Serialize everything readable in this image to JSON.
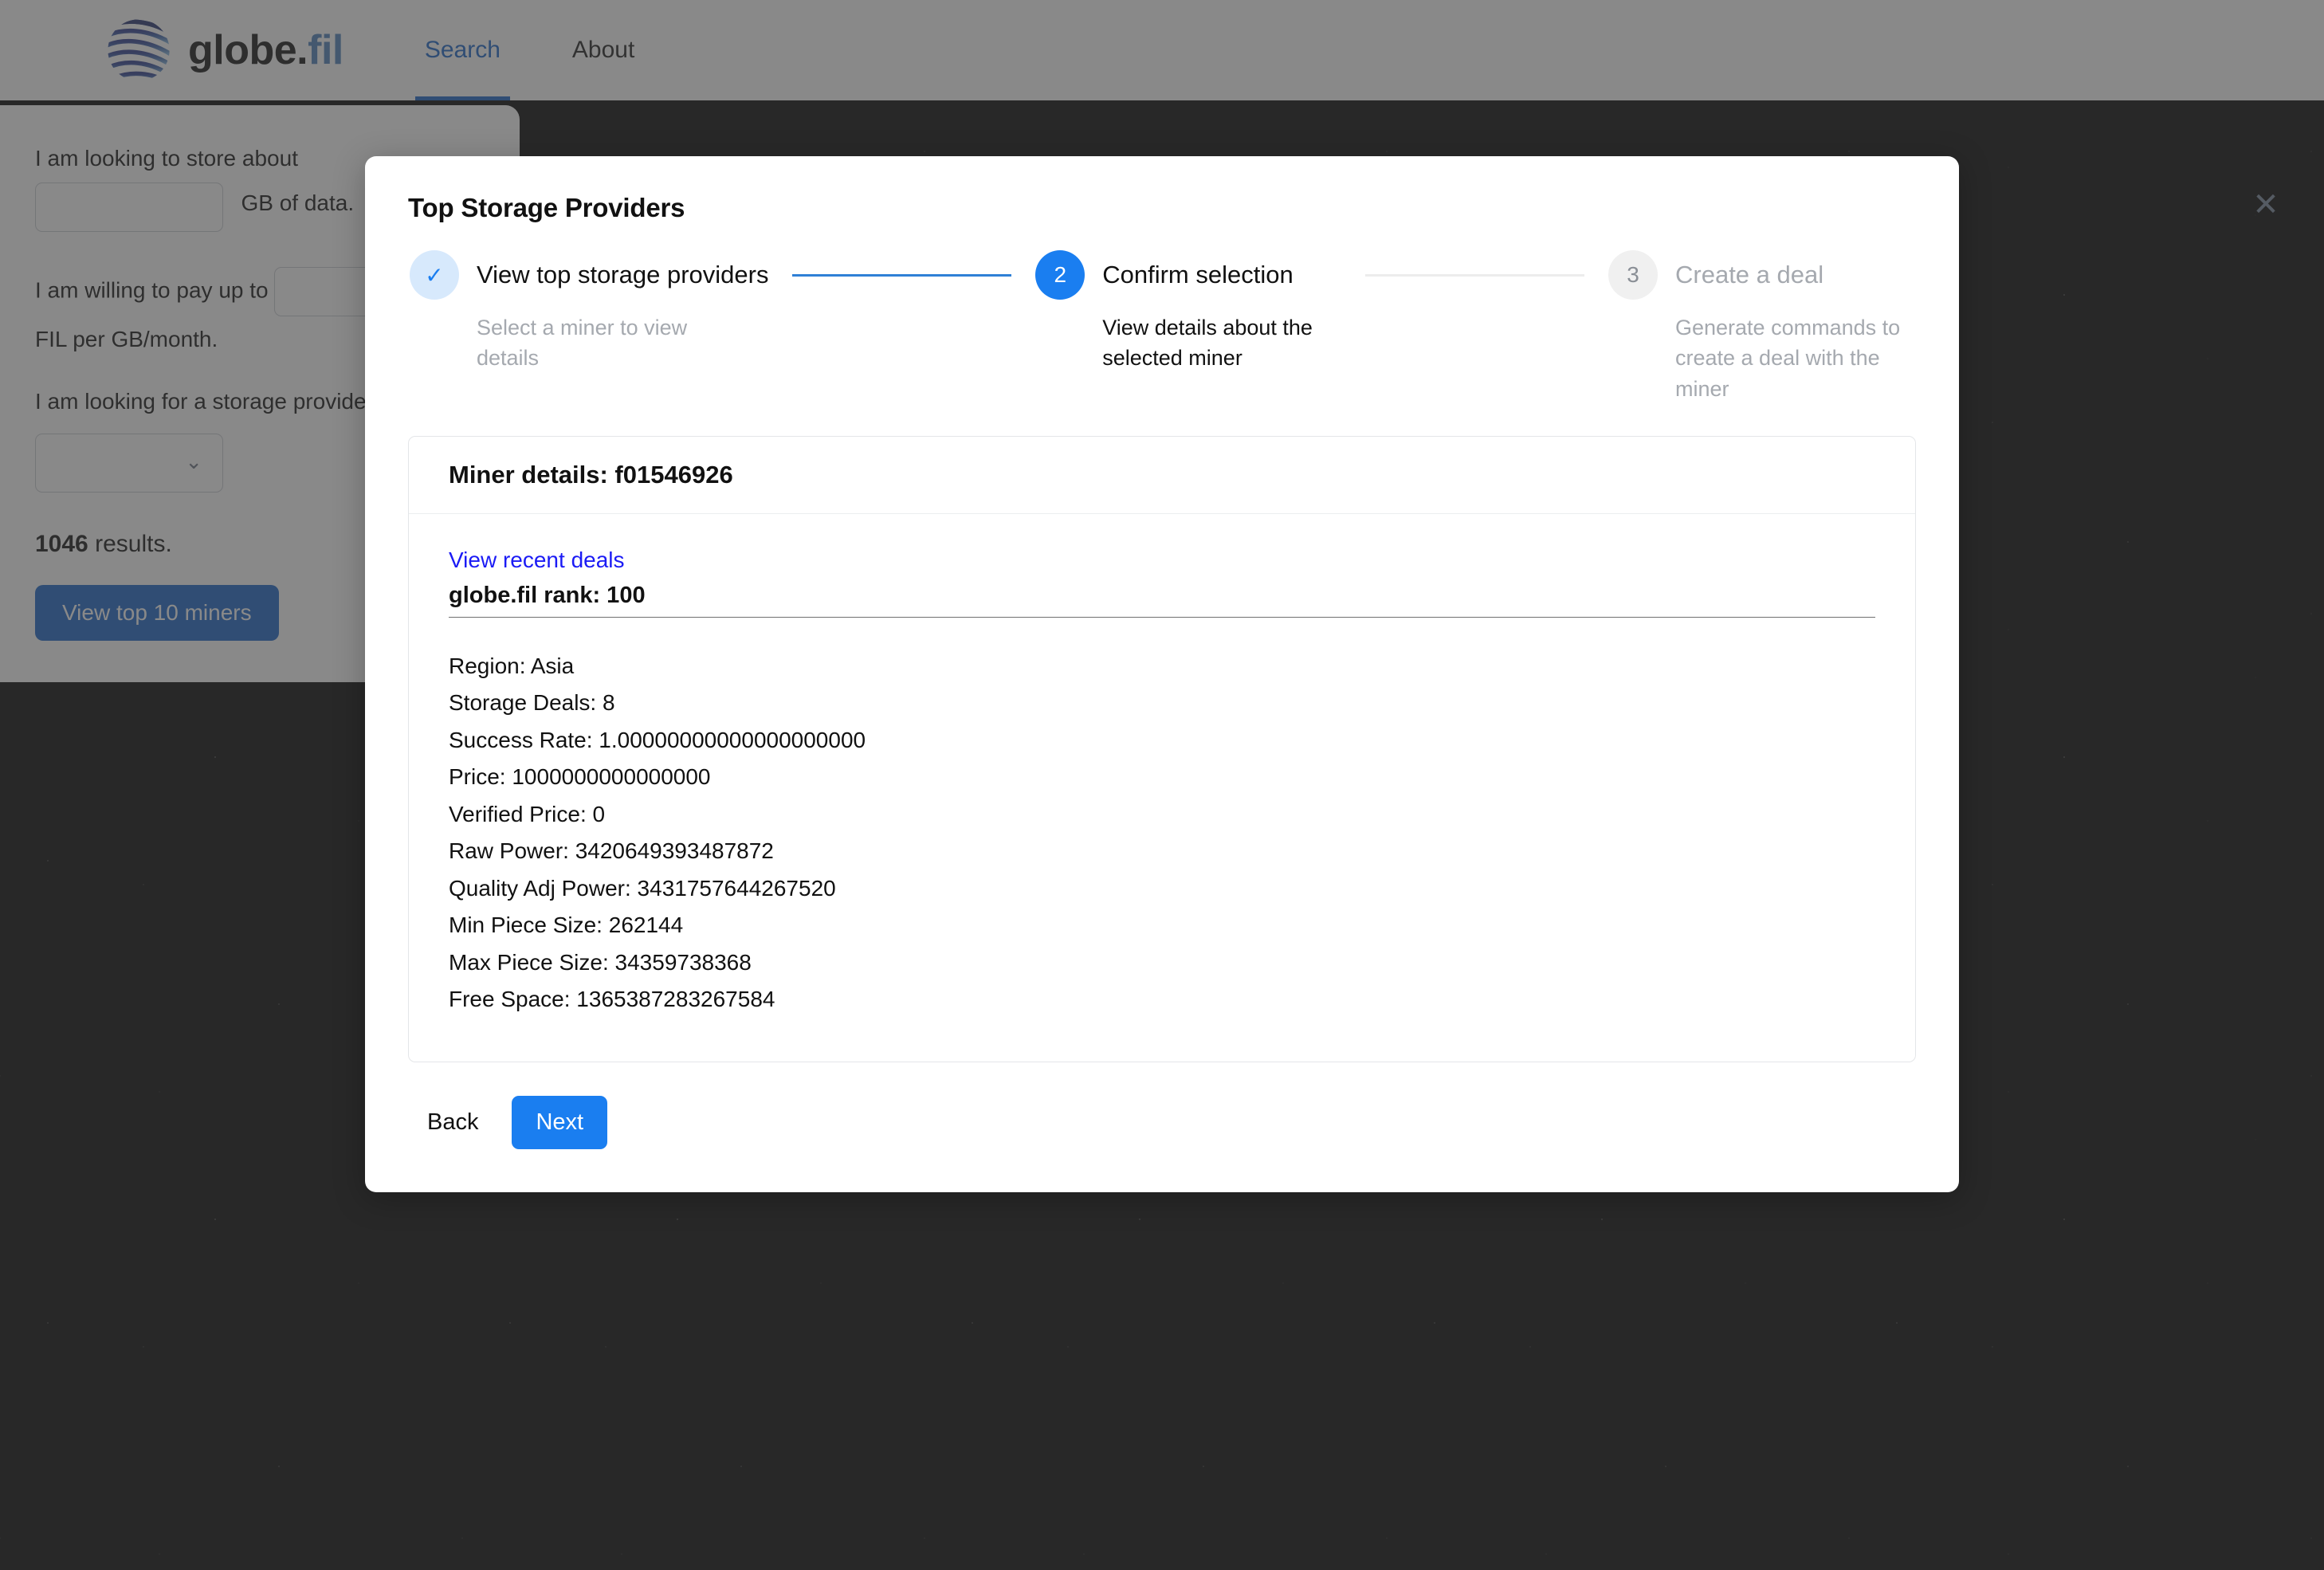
{
  "brand": {
    "name_main": "globe",
    "name_dot": ".",
    "name_suffix": "fil",
    "logo_icon": "globe-icon"
  },
  "nav": {
    "links": [
      {
        "label": "Search",
        "active": true
      },
      {
        "label": "About",
        "active": false
      }
    ]
  },
  "search_panel": {
    "store_label_prefix": "I am looking to store about",
    "store_value": "",
    "store_placeholder": "",
    "store_label_suffix": "GB of data.",
    "pay_label_prefix": "I am willing to pay up to",
    "pay_value": "",
    "pay_placeholder": "",
    "pay_label_suffix": "FIL per GB/month.",
    "provider_label": "I am looking for a storage provider in",
    "provider_selected": "",
    "provider_options": [
      ""
    ],
    "chevron_icon": "chevron-down-icon",
    "results_count": "1046",
    "results_suffix": " results.",
    "cta_label": "View top 10 miners"
  },
  "modal": {
    "title": "Top Storage Providers",
    "close_icon": "close-icon",
    "steps": [
      {
        "marker": "✓",
        "state": "done",
        "label": "View top storage providers",
        "desc": "Select a miner to view details"
      },
      {
        "marker": "2",
        "state": "active",
        "label": "Confirm selection",
        "desc": "View details about the selected miner"
      },
      {
        "marker": "3",
        "state": "idle",
        "label": "Create a deal",
        "desc": "Generate commands to create a deal with the miner"
      }
    ],
    "detail_card": {
      "header": "Miner details: f01546926",
      "deals_link": "View recent deals",
      "rank_line": "globe.fil rank: 100",
      "rows": [
        "Region: Asia",
        "Storage Deals: 8",
        "Success Rate: 1.00000000000000000000",
        "Price: 1000000000000000",
        "Verified Price: 0",
        "Raw Power: 3420649393487872",
        "Quality Adj Power: 3431757644267520",
        "Min Piece Size: 262144",
        "Max Piece Size: 34359738368",
        "Free Space: 1365387283267584"
      ]
    },
    "back_label": "Back",
    "next_label": "Next"
  },
  "colors": {
    "accent_blue": "#1a7ef0",
    "nav_active": "#1763c7",
    "brand_fil": "#4a7fba",
    "link_blue": "#1b1bf5",
    "cta_blue": "#1763c7",
    "muted_gray": "#a5a9af"
  }
}
